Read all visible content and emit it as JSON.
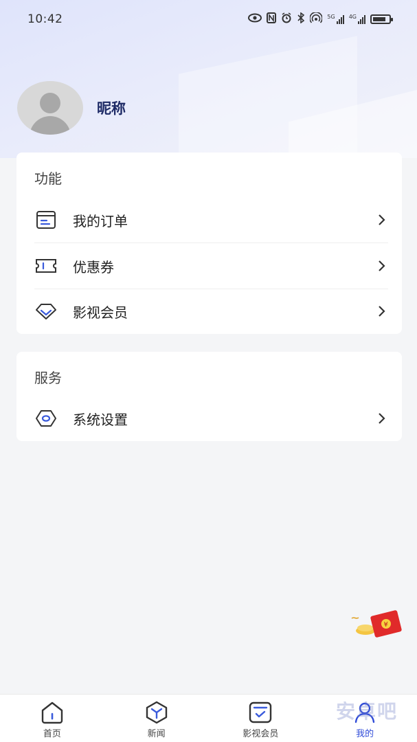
{
  "status_bar": {
    "time": "10:42",
    "net1": "5G",
    "net2": "4G",
    "icons": [
      "eye-icon",
      "nfc-icon",
      "alarm-icon",
      "bluetooth-icon",
      "hotspot-icon",
      "signal-icon",
      "battery-icon"
    ]
  },
  "profile": {
    "nickname": "昵称"
  },
  "section_functions": {
    "title": "功能",
    "items": [
      {
        "label": "我的订单",
        "icon": "order-icon"
      },
      {
        "label": "优惠券",
        "icon": "coupon-icon"
      },
      {
        "label": "影视会员",
        "icon": "diamond-icon"
      }
    ]
  },
  "section_services": {
    "title": "服务",
    "items": [
      {
        "label": "系统设置",
        "icon": "settings-icon"
      }
    ]
  },
  "tabbar": {
    "tabs": [
      {
        "label": "首页",
        "icon": "home-icon"
      },
      {
        "label": "新闻",
        "icon": "news-icon"
      },
      {
        "label": "影视会员",
        "icon": "membership-icon"
      },
      {
        "label": "我的",
        "icon": "profile-icon",
        "active": true
      }
    ]
  },
  "colors": {
    "accent": "#2f4bd8",
    "nickname": "#1d2a66",
    "background": "#f4f5f7"
  },
  "watermark": "安卓吧"
}
